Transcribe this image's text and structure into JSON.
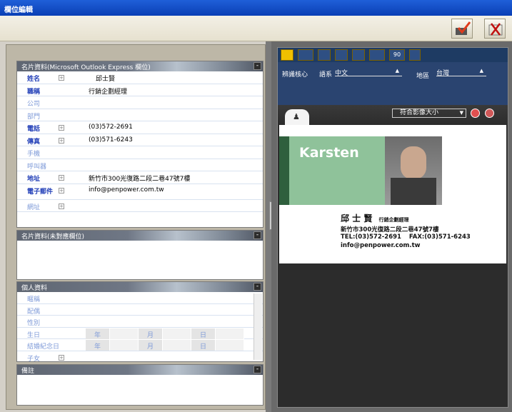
{
  "window": {
    "title": "欄位編輯"
  },
  "toolbar": {
    "ok_icon": "check-icon",
    "cancel_icon": "close-icon"
  },
  "panels": {
    "outlook": {
      "title": "名片資料(Microsoft Outlook Express 欄位)",
      "rows": [
        {
          "label": "姓名",
          "value": "邱士賢",
          "bold": true,
          "plus": true,
          "dot": true
        },
        {
          "label": "職稱",
          "value": "行銷企劃經理",
          "bold": true,
          "plus": false
        },
        {
          "label": "公司",
          "value": "",
          "bold": false,
          "plus": false
        },
        {
          "label": "部門",
          "value": "",
          "bold": false,
          "plus": false
        },
        {
          "label": "電話",
          "value": "(03)572-2691",
          "bold": true,
          "plus": true
        },
        {
          "label": "傳真",
          "value": "(03)571-6243",
          "bold": true,
          "plus": true
        },
        {
          "label": "手機",
          "value": "",
          "bold": false,
          "plus": false
        },
        {
          "label": "呼叫器",
          "value": "",
          "bold": false,
          "plus": false
        },
        {
          "label": "地址",
          "value": "新竹市300光復路二段二巷47號7樓",
          "bold": true,
          "plus": true
        },
        {
          "label": "電子郵件",
          "value": "info@penpower.com.tw",
          "bold": true,
          "plus": true
        },
        {
          "label": "網址",
          "value": "",
          "bold": false,
          "plus": true
        }
      ]
    },
    "unmapped": {
      "title": "名片資料(未對應欄位)"
    },
    "personal": {
      "title": "個人資料",
      "rows": [
        "暱稱",
        "配偶",
        "性別",
        "生日",
        "結婚紀念日",
        "子女"
      ],
      "date_labels": {
        "year": "年",
        "month": "月",
        "day": "日"
      }
    },
    "notes": {
      "title": "備註"
    }
  },
  "right": {
    "toolbar_icons": [
      "move-icon",
      "fit-width-icon",
      "fit-page-icon",
      "fit-height-icon",
      "zoom-icon",
      "rotate-icon",
      "rotate-90-icon",
      "save-icon"
    ],
    "rotate_label": "90",
    "settings": {
      "core_label": "辨識核心",
      "lang_label": "語系",
      "lang_value": "中文",
      "region_label": "地區",
      "region_value": "台灣"
    },
    "zoom_select": "符合影像大小",
    "card": {
      "name_en": "Karsten",
      "name_zh": "邱 士 賢",
      "title_zh": "行銷企劃經理",
      "address": "新竹市300光復路二段二巷47號7樓",
      "tel": "TEL:(03)572-2691",
      "fax": "FAX:(03)571-6243",
      "email": "info@penpower.com.tw"
    }
  }
}
